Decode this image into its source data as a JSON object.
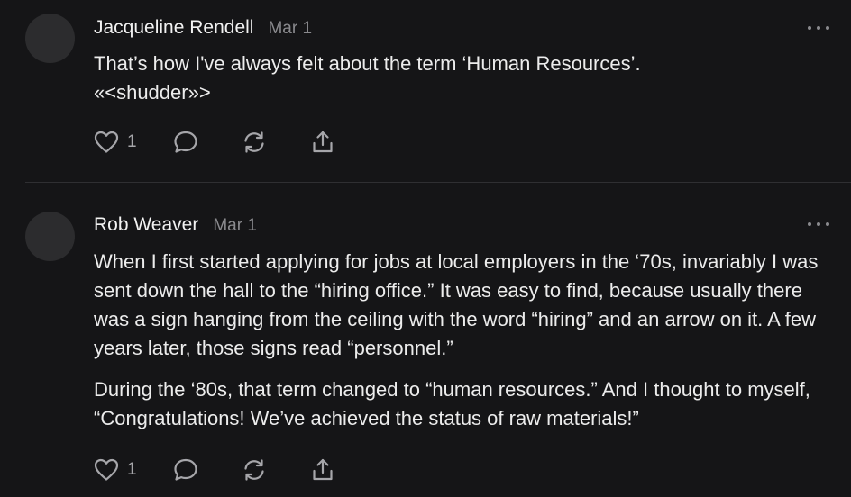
{
  "comments": [
    {
      "author": "Jacqueline Rendell",
      "date": "Mar 1",
      "paragraphs": [
        "That’s how I've always felt about the term ‘Human Resources’. «<shudder»>"
      ],
      "like_count": "1",
      "icons": {
        "avatar": "avatar-placeholder",
        "more": "more-horizontal-icon",
        "like": "heart-icon",
        "reply": "comment-bubble-icon",
        "restack": "restack-icon",
        "share": "share-icon"
      }
    },
    {
      "author": "Rob Weaver",
      "date": "Mar 1",
      "paragraphs": [
        "When I first started applying for jobs at local employers in the ‘70s, invariably I was sent down the hall to the “hiring office.” It was easy to find, because usually there was a sign hanging from the ceiling with the word “hiring” and an arrow on it. A few years later, those signs read “personnel.”",
        "During the ‘80s, that term changed to “human resources.” And I thought to myself, “Congratulations! We’ve achieved the status of raw materials!”"
      ],
      "like_count": "1",
      "icons": {
        "avatar": "avatar-placeholder",
        "more": "more-horizontal-icon",
        "like": "heart-icon",
        "reply": "comment-bubble-icon",
        "restack": "restack-icon",
        "share": "share-icon"
      }
    }
  ],
  "colors": {
    "background": "#151517",
    "text": "#ececec",
    "muted": "#8a8a8e",
    "avatar": "#2c2c2e",
    "divider": "#2f2f32"
  }
}
